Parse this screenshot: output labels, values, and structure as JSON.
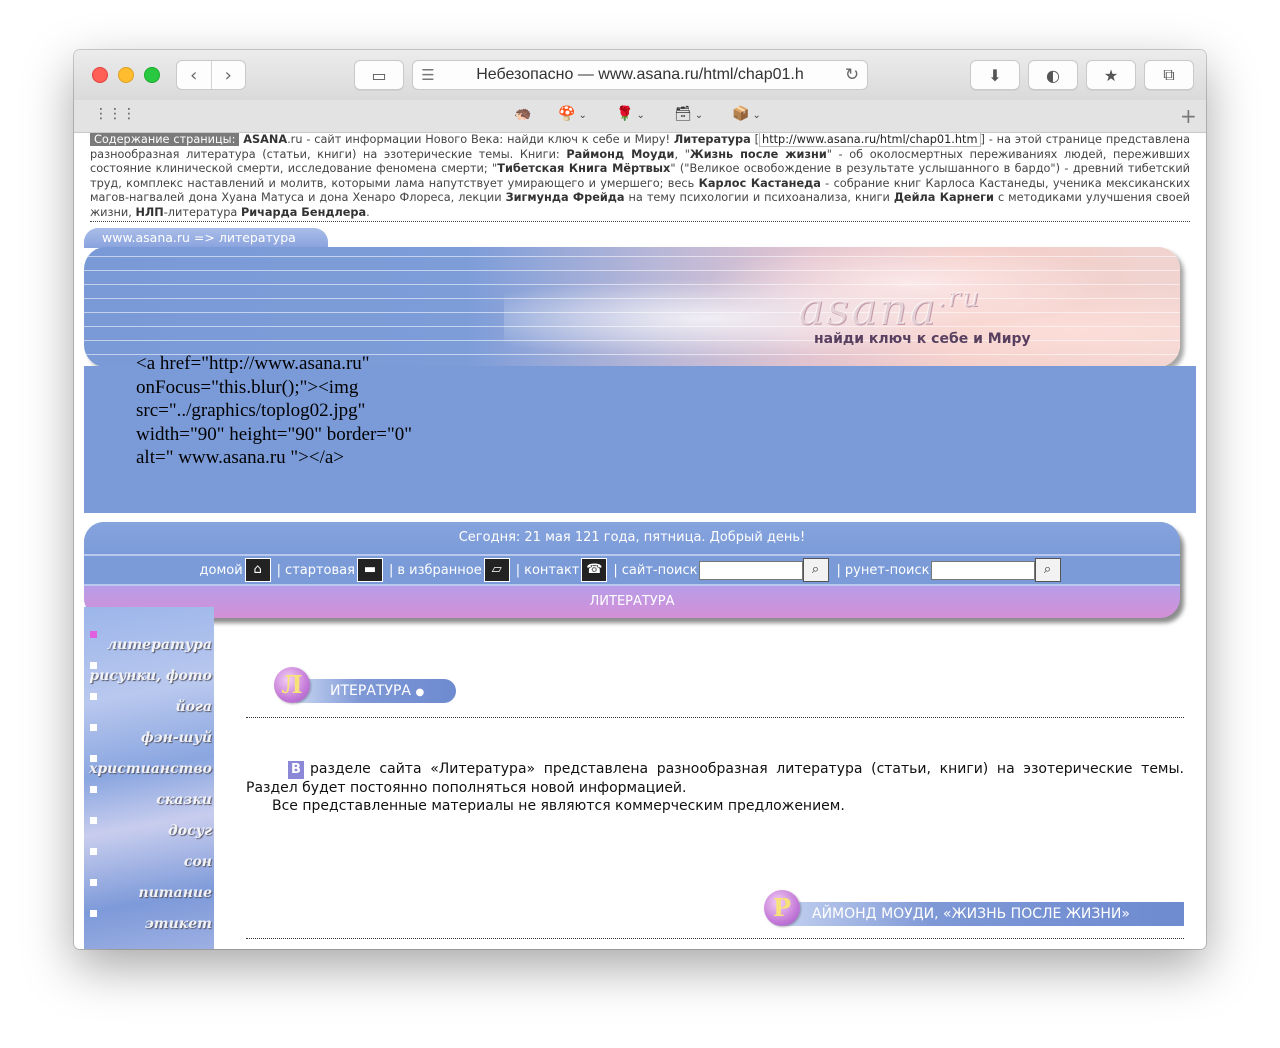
{
  "browser": {
    "address": "Небезопасно — www.asana.ru/html/chap01.h",
    "bookmarks": [
      {
        "glyph": "🦔",
        "has_menu": false
      },
      {
        "glyph": "🍄",
        "has_menu": true
      },
      {
        "glyph": "🌹",
        "has_menu": true
      },
      {
        "glyph": "🗃",
        "has_menu": true
      },
      {
        "glyph": "📦",
        "has_menu": true
      }
    ],
    "plus": "+"
  },
  "intro": {
    "label": "Содержание страницы:",
    "brand": "ASANA",
    "t1": ".ru - сайт информации Нового Века: найди ключ к себе и Миру! ",
    "lit": "Литература",
    "t2": " [",
    "url": "http://www.asana.ru/html/chap01.htm",
    "t3": "] - на этой странице представлена разнообразная литература (статьи, книги) на эзотерические темы. Книги: ",
    "moody": "Раймонд Моуди",
    "t4": ", \"",
    "life": "Жизнь после жизни",
    "t5": "\" - об околосмертных переживаниях людей, переживших состояние клинической смерти, исследование феномена смерти; \"",
    "tibet": "Тибетская Книга Мёртвых",
    "t6": "\" (\"Великое освобождение в результате услышанного в бардо\") - древний тибетский труд, комплекс наставлений и молитв, которыми лама напутствует умирающего и умершего; весь ",
    "castaneda": "Карлос Кастанеда",
    "t7": " - собрание книг Карлоса Кастанеды, ученика мексиканских магов-нагвалей дона Хуана Матуса и дона Хенаро Флореса, лекции ",
    "freud": "Зигмунда Фрейда",
    "t8": " на тему психологии и психоанализа, книги ",
    "carnegie": "Дейла Карнеги",
    "t9": " с методиками улучшения своей жизни, ",
    "nlp": "НЛП",
    "t10": "-литература ",
    "bandler": "Ричарда Бендлера",
    "t11": "."
  },
  "breadcrumb": "www.asana.ru => литература",
  "banner": {
    "logo": "asana",
    "logo_suffix": ".ru",
    "tagline": "найди ключ к себе и Миру"
  },
  "broken_image_alt": "<a href=\"http://www.asana.ru\" onFocus=\"this.blur();\"><img src=\"../graphics/toplog02.jpg\" width=\"90\" height=\"90\" border=\"0\" alt=\" www.asana.ru \"></a>",
  "nav": {
    "greeting": "Сегодня: 21 мая 121 года, пятница. Добрый день!",
    "home": "домой",
    "start": "стартовая",
    "favorites": "в избранное",
    "contact": "контакт",
    "site_search": "сайт-поиск",
    "runet_search": "рунет-поиск",
    "section": "ЛИТЕРАТУРА",
    "sep": "|"
  },
  "sidebar": [
    {
      "label": "литература",
      "active": true
    },
    {
      "label": "рисунки, фото",
      "active": false
    },
    {
      "label": "йога",
      "active": false
    },
    {
      "label": "фэн-шуй",
      "active": false
    },
    {
      "label": "христианство",
      "active": false
    },
    {
      "label": "сказки",
      "active": false
    },
    {
      "label": "досуг",
      "active": false
    },
    {
      "label": "сон",
      "active": false
    },
    {
      "label": "питание",
      "active": false
    },
    {
      "label": "этикет",
      "active": false
    }
  ],
  "section1": {
    "cap": "Л",
    "title": "ИТЕРАТУРА",
    "bullet": "●",
    "dropcap": "В",
    "p1": "разделе сайта «Литература» представлена разнообразная литература (статьи, книги) на эзотерические темы. Раздел будет постоянно пополняться новой информацией.",
    "p2": "Все представленные материалы не являются коммерческим предложением."
  },
  "section2": {
    "cap": "Р",
    "title": "АЙМОНД МОУДИ, «ЖИЗНЬ ПОСЛЕ ЖИЗНИ»"
  }
}
